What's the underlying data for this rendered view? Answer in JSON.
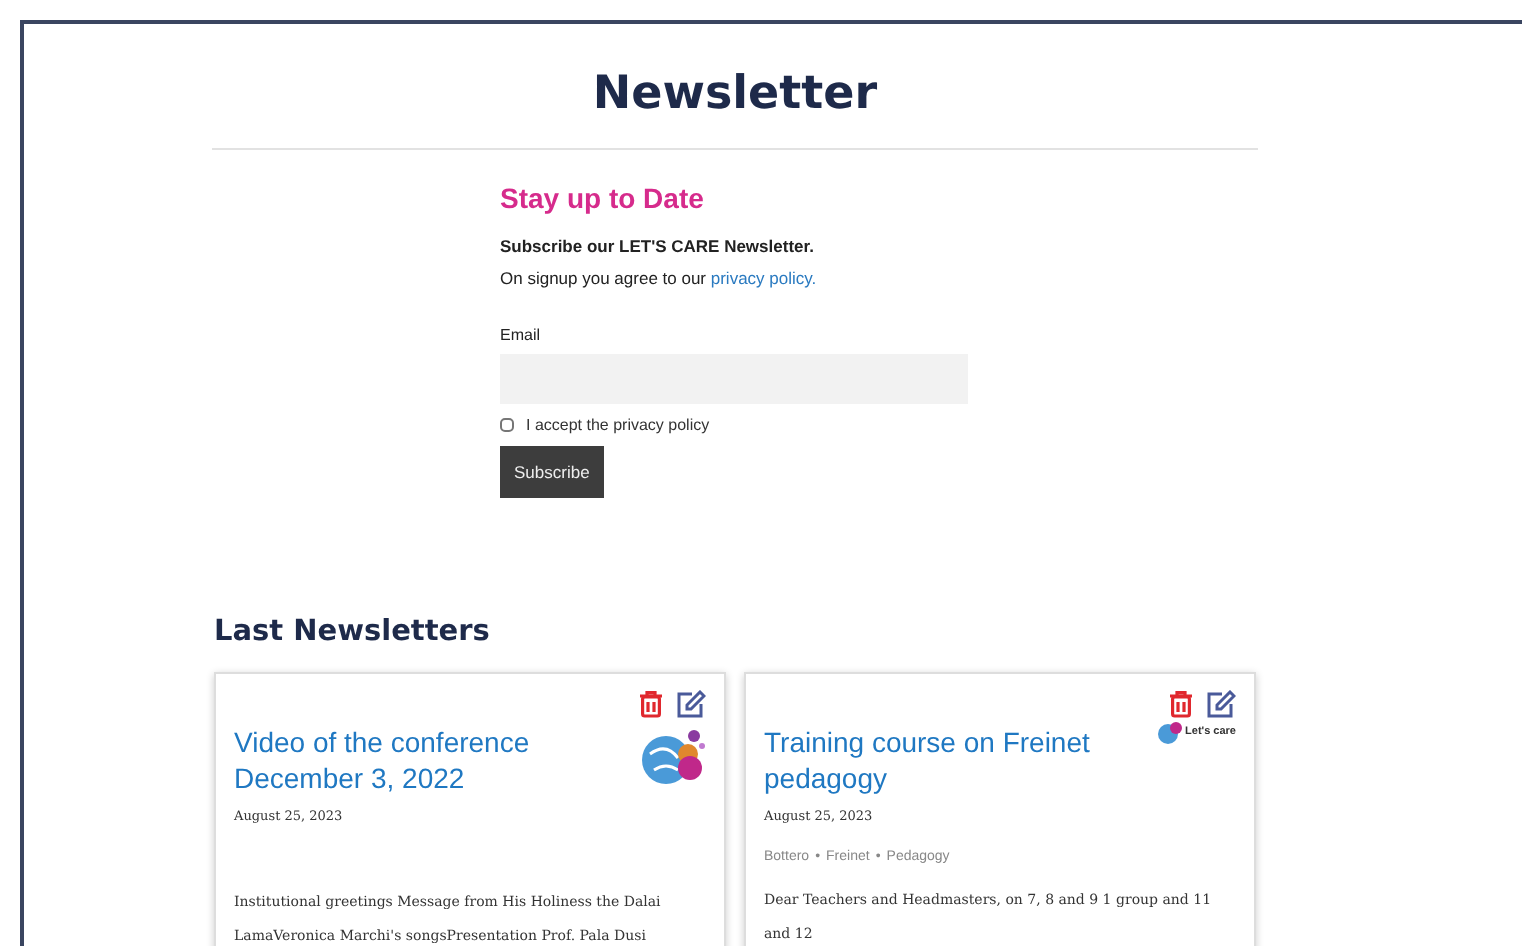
{
  "page_title": "Newsletter",
  "signup": {
    "heading": "Stay up to Date",
    "intro": "Subscribe our LET'S CARE Newsletter.",
    "consent_text": "On signup you agree to our ",
    "consent_link": "privacy policy.",
    "email_label": "Email",
    "checkbox": {
      "label": "I accept the privacy policy",
      "checked": false
    },
    "button": "Subscribe"
  },
  "section_title": "Last Newsletters",
  "cards": [
    {
      "title": "Video of the conference December 3, 2022",
      "date": "August 25, 2023",
      "excerpt": "Institutional greetings Message from His Holiness the Dalai LamaVeronica Marchi's songsPresentation Prof. Pala Dusi"
    },
    {
      "title": "Training course on Freinet pedagogy",
      "date": "August 25, 2023",
      "tags": [
        "Bottero",
        "Freinet",
        "Pedagogy"
      ],
      "tag_separator": "•",
      "excerpt": "Dear Teachers and Headmasters, on 7, 8 and 9 1 group and 11 and 12",
      "logo_text": "Let's care"
    }
  ]
}
